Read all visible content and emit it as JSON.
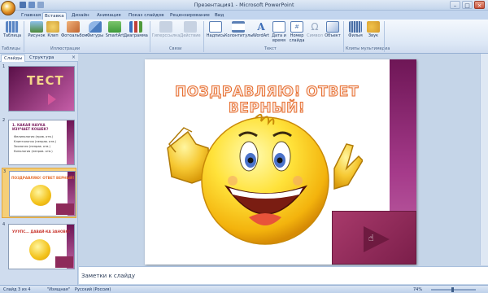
{
  "window": {
    "title": "Презентация1 - Microsoft PowerPoint"
  },
  "ribbon_tabs": [
    {
      "label": "Главная",
      "active": false
    },
    {
      "label": "Вставка",
      "active": true
    },
    {
      "label": "Дизайн",
      "active": false
    },
    {
      "label": "Анимация",
      "active": false
    },
    {
      "label": "Показ слайдов",
      "active": false
    },
    {
      "label": "Рецензирование",
      "active": false
    },
    {
      "label": "Вид",
      "active": false
    }
  ],
  "ribbon": {
    "items": [
      {
        "label": "Таблица",
        "icon": "table-icon",
        "color": "#5b86c4",
        "enabled": true
      },
      {
        "label": "Рисунок",
        "icon": "picture-icon",
        "color": "#4f8a3a",
        "enabled": true
      },
      {
        "label": "Клип",
        "icon": "clipart-icon",
        "color": "#d4a43a",
        "enabled": true
      },
      {
        "label": "Фотоальбом",
        "icon": "photo-album-icon",
        "color": "#c0652f",
        "enabled": true
      },
      {
        "label": "Фигуры",
        "icon": "shapes-icon",
        "color": "#4a7cc0",
        "enabled": true
      },
      {
        "label": "SmartArt",
        "icon": "smartart-icon",
        "color": "#3f9a3a",
        "enabled": true
      },
      {
        "label": "Диаграмма",
        "icon": "chart-icon",
        "color": "#3a6fc0",
        "enabled": true
      },
      {
        "label": "Гиперссылка",
        "icon": "hyperlink-icon",
        "color": "#9aabc3",
        "enabled": false
      },
      {
        "label": "Действие",
        "icon": "action-icon",
        "color": "#9aabc3",
        "enabled": false
      },
      {
        "label": "Надпись",
        "icon": "textbox-icon",
        "color": "#5a7fb5",
        "enabled": true
      },
      {
        "label": "Колонтитулы",
        "icon": "header-footer-icon",
        "color": "#5a7fb5",
        "enabled": true
      },
      {
        "label": "WordArt",
        "icon": "wordart-icon",
        "color": "#3f6fb8",
        "enabled": true
      },
      {
        "label": "Дата и время",
        "icon": "date-time-icon",
        "color": "#5a7fb5",
        "enabled": true
      },
      {
        "label": "Номер слайда",
        "icon": "slide-number-icon",
        "color": "#5a7fb5",
        "enabled": true
      },
      {
        "label": "Символ",
        "icon": "symbol-icon",
        "color": "#9aabc3",
        "enabled": false
      },
      {
        "label": "Объект",
        "icon": "object-icon",
        "color": "#5a7fb5",
        "enabled": true
      },
      {
        "label": "Фильм",
        "icon": "movie-icon",
        "color": "#4a6fa5",
        "enabled": true
      },
      {
        "label": "Звук",
        "icon": "sound-icon",
        "color": "#d49a2a",
        "enabled": true
      }
    ],
    "groups": [
      "Таблицы",
      "Иллюстрации",
      "Связи",
      "Текст",
      "Клипы мультимедиа"
    ]
  },
  "side_panel": {
    "tabs": [
      {
        "label": "Слайды",
        "active": true
      },
      {
        "label": "Структура",
        "active": false
      }
    ],
    "close_glyph": "×",
    "slides": [
      {
        "number": "1",
        "selected": false,
        "title": "ТЕСТ"
      },
      {
        "number": "2",
        "selected": false,
        "title": "1. КАКАЯ НАУКА ИЗУЧАЕТ КОШЕК?",
        "options": [
          "Фелинология (прав. отв.)",
          "Клиптология (неправ. отв.)",
          "Зоология (неправ. отв.)",
          "Кинология (неправ. отв.)"
        ]
      },
      {
        "number": "3",
        "selected": true,
        "title": "ПОЗДРАВЛЯЮ! ОТВЕТ ВЕРНЫЙ!"
      },
      {
        "number": "4",
        "selected": false,
        "title": "УУУПС... ДАВАЙ-КА ЗАНОВО!"
      }
    ]
  },
  "slide": {
    "title": "ПОЗДРАВЛЯЮ! ОТВЕТ ВЕРНЫЙ!"
  },
  "notes": {
    "placeholder": "Заметки к слайду"
  },
  "status_bar": {
    "slide_info": "Слайд 3 из 4",
    "theme": "\"Изящная\"",
    "language": "Русский (Россия)",
    "zoom": "74%"
  },
  "colors": {
    "accent_band": "#8b2470",
    "title_stroke": "#e66d2d",
    "play_panel": "#8e2a5a",
    "selected_thumb": "#f5cf78"
  }
}
